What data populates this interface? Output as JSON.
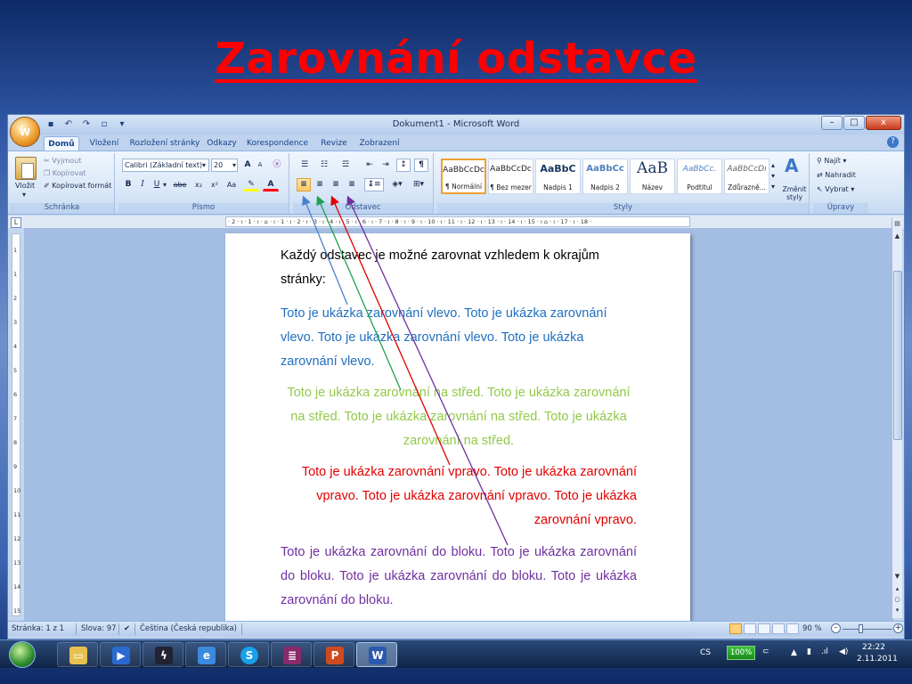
{
  "slide": {
    "title": "Zarovnání odstavce"
  },
  "window": {
    "title": "Dokument1 - Microsoft Word",
    "office_button_glyph": "W",
    "quick_access": [
      "💾",
      "↶",
      "↷",
      "▾"
    ],
    "controls": {
      "minimize": "–",
      "maximize": "□",
      "close": "x"
    }
  },
  "tabs": [
    "Domů",
    "Vložení",
    "Rozložení stránky",
    "Odkazy",
    "Korespondence",
    "Revize",
    "Zobrazení"
  ],
  "active_tab": "Domů",
  "ribbon": {
    "clipboard": {
      "group_label": "Schránka",
      "paste": "Vložit",
      "cut": "Vyjmout",
      "copy": "Kopírovat",
      "format_painter": "Kopírovat formát"
    },
    "font": {
      "group_label": "Písmo",
      "font_name": "Calibri (Základní text)",
      "font_size": "20",
      "bold": "B",
      "italic": "I",
      "underline": "U",
      "strike": "abe",
      "subscript": "x₂",
      "superscript": "x²",
      "change_case": "Aa",
      "grow": "A",
      "shrink": "A",
      "clear": "⌫"
    },
    "paragraph": {
      "group_label": "Odstavec",
      "align_left": "≡",
      "align_center": "≡",
      "align_right": "≡",
      "justify": "≡",
      "show_marks": "¶"
    },
    "styles": {
      "group_label": "Styly",
      "cards": [
        {
          "sample": "AaBbCcDc",
          "name": "¶ Normální"
        },
        {
          "sample": "AaBbCcDc",
          "name": "¶ Bez mezer"
        },
        {
          "sample": "AaBbC",
          "name": "Nadpis 1"
        },
        {
          "sample": "AaBbCc",
          "name": "Nadpis 2"
        },
        {
          "sample": "AaB",
          "name": "Název"
        },
        {
          "sample": "AaBbCc.",
          "name": "Podtitul"
        },
        {
          "sample": "AaBbCcDı",
          "name": "Zdůrazně..."
        }
      ],
      "change_styles": "Změnit styly"
    },
    "editing": {
      "group_label": "Úpravy",
      "find": "Najít",
      "replace": "Nahradit",
      "select": "Vybrat"
    }
  },
  "ruler": {
    "horizontal": "· 2 · ı · 1 · ı · ⌂ · ı · 1 · ı · 2 · ı · 3 · ı · 4 · ı · 5 · ı · 6 · ı · 7 · ı · 8 · ı · 9 · ı · 10 · ı · 11 · ı · 12 · ı · 13 · ı · 14 · ı · 15 · ı ⌂ · ı · 17 · ı · 18 ·",
    "vertical": [
      "1",
      "1",
      "2",
      "3",
      "4",
      "5",
      "6",
      "7",
      "8",
      "9",
      "10",
      "11",
      "12",
      "13",
      "14",
      "15"
    ],
    "corner": "L"
  },
  "document": {
    "intro": "Každý odstavec je možné zarovnat vzhledem k okrajům stránky:",
    "left": "Toto je ukázka zarovnání vlevo. Toto je ukázka zarovnání vlevo. Toto je ukázka zarovnání vlevo. Toto je ukázka zarovnání vlevo.",
    "center": "Toto je ukázka zarovnání na střed. Toto je ukázka zarovnání na střed. Toto je ukázka zarovnání na střed. Toto je ukázka zarovnání na střed.",
    "right": "Toto je ukázka zarovnání vpravo. Toto je ukázka zarovnání vpravo. Toto je ukázka zarovnání vpravo. Toto je ukázka zarovnání vpravo.",
    "justify": "Toto je ukázka zarovnání do bloku. Toto je ukázka zarovnání do bloku. Toto je ukázka zarovnání do bloku. Toto je ukázka zarovnání do bloku."
  },
  "colors": {
    "title": "#ff0000",
    "left": "#1f6fc0",
    "center": "#92c94a",
    "right": "#e00000",
    "justify": "#7030a0",
    "arrow_left": "#4a80d0",
    "arrow_center": "#20a050",
    "arrow_right": "#e00000",
    "arrow_justify": "#7030a0"
  },
  "statusbar": {
    "page": "Stránka: 1 z 1",
    "words": "Slova: 97",
    "language": "Čeština (Česká republika)",
    "zoom": "90 %"
  },
  "taskbar": {
    "apps": [
      "explorer",
      "media-player",
      "winamp",
      "internet-explorer",
      "skype",
      "winrar",
      "powerpoint",
      "word"
    ],
    "language": "CS",
    "battery": "100%",
    "time": "22:22",
    "date": "2.11.2011"
  }
}
